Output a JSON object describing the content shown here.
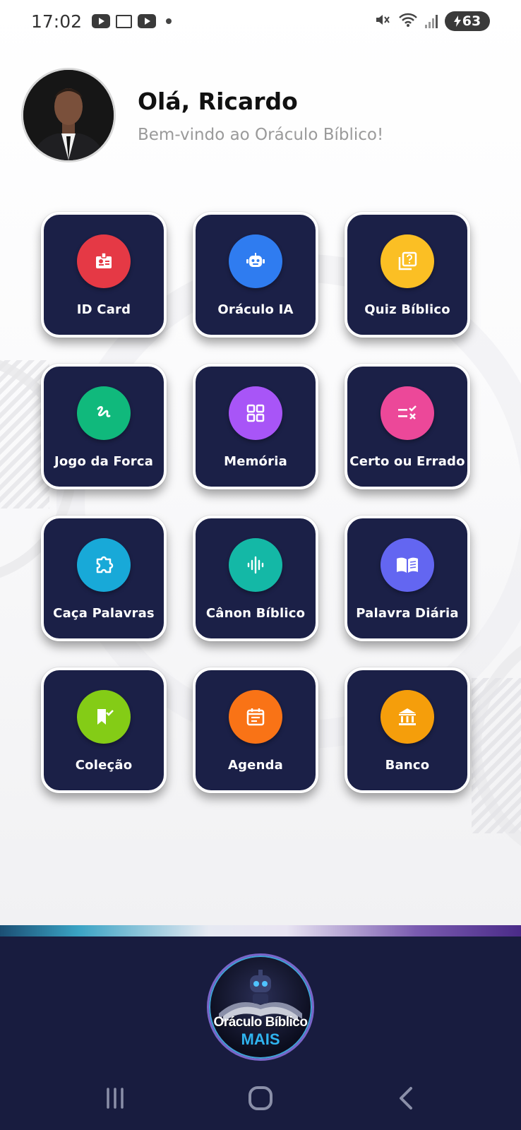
{
  "status_bar": {
    "time": "17:02",
    "battery": "63",
    "notification_icons": [
      "youtube-icon",
      "calendar-icon",
      "youtube-icon"
    ],
    "system_icons": [
      "mute-icon",
      "wifi-icon",
      "signal-icon",
      "battery-icon"
    ]
  },
  "header": {
    "greeting": "Olá, Ricardo",
    "subtitle": "Bem-vindo ao Oráculo Bíblico!"
  },
  "menu": {
    "items": [
      {
        "label": "ID Card",
        "icon": "id-badge-icon",
        "color": "#e53945"
      },
      {
        "label": "Oráculo IA",
        "icon": "robot-icon",
        "color": "#2f7cf0"
      },
      {
        "label": "Quiz Bíblico",
        "icon": "quiz-icon",
        "color": "#fbbf24"
      },
      {
        "label": "Jogo da Forca",
        "icon": "gesture-icon",
        "color": "#10b97c"
      },
      {
        "label": "Memória",
        "icon": "grid-icon",
        "color": "#a855f7"
      },
      {
        "label": "Certo ou Errado",
        "icon": "checklist-icon",
        "color": "#ec4899"
      },
      {
        "label": "Caça Palavras",
        "icon": "puzzle-icon",
        "color": "#18a9d8"
      },
      {
        "label": "Cânon Bíblico",
        "icon": "audio-wave-icon",
        "color": "#14b8a6"
      },
      {
        "label": "Palavra Diária",
        "icon": "book-icon",
        "color": "#6366f1"
      },
      {
        "label": "Coleção",
        "icon": "bookmark-check-icon",
        "color": "#84cc16"
      },
      {
        "label": "Agenda",
        "icon": "calendar-icon",
        "color": "#f97316"
      },
      {
        "label": "Banco",
        "icon": "bank-icon",
        "color": "#f59e0b"
      }
    ]
  },
  "footer": {
    "logo_title": "Oráculo Bíblico",
    "logo_sub": "MAIS",
    "nav": [
      "recent-apps-icon",
      "home-icon",
      "back-icon"
    ]
  },
  "colors": {
    "tile_bg": "#1b2047",
    "footer_bg": "#181c3f"
  }
}
